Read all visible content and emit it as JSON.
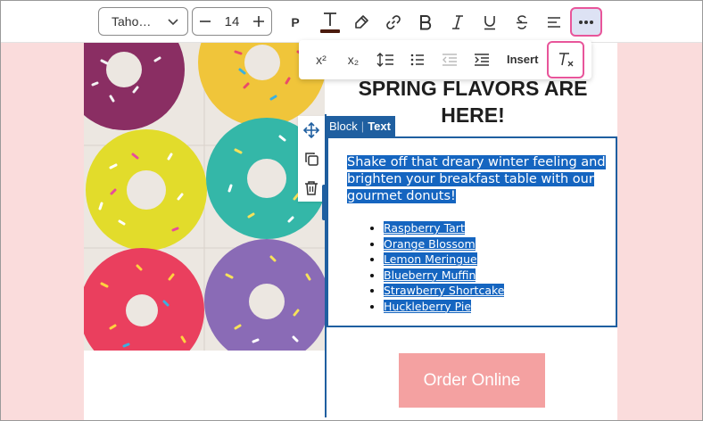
{
  "toolbar": {
    "font_family": "Taho…",
    "font_size": "14",
    "paragraph_label": "P",
    "icons": [
      "chevron-down-icon",
      "minus-icon",
      "plus-icon",
      "text-color-icon",
      "highlighter-icon",
      "link-icon",
      "bold-icon",
      "italic-icon",
      "underline-icon",
      "strikethrough-icon",
      "align-icon",
      "more-icon"
    ]
  },
  "popup": {
    "superscript_label": "x²",
    "subscript_label": "x₂",
    "insert_label": "Insert",
    "icons": [
      "superscript-icon",
      "subscript-icon",
      "line-height-icon",
      "list-icon",
      "outdent-icon",
      "indent-icon",
      "clear-formatting-icon"
    ]
  },
  "content": {
    "headline": "SPRING FLAVORS ARE HERE!",
    "paragraph": "Shake off that dreary winter feeling and brighten your breakfast table with our gourmet donuts!",
    "flavors": [
      "Raspberry Tart",
      "Orange Blossom",
      "Lemon Meringue",
      "Blueberry Muffin",
      "Strawberry Shortcake",
      "Huckleberry Pie"
    ],
    "order_button": "Order Online"
  },
  "block_toolbar": {
    "block_label": "Block",
    "separator": "|",
    "text_label": "Text",
    "side_icons": [
      "move-icon",
      "duplicate-icon",
      "delete-icon"
    ]
  },
  "colors": {
    "accent_pink": "#e8559a",
    "selection_blue": "#1565c0",
    "block_blue": "#1f5fa0",
    "button_pink": "#f4a1a1",
    "background_pink": "#fadcdc"
  }
}
